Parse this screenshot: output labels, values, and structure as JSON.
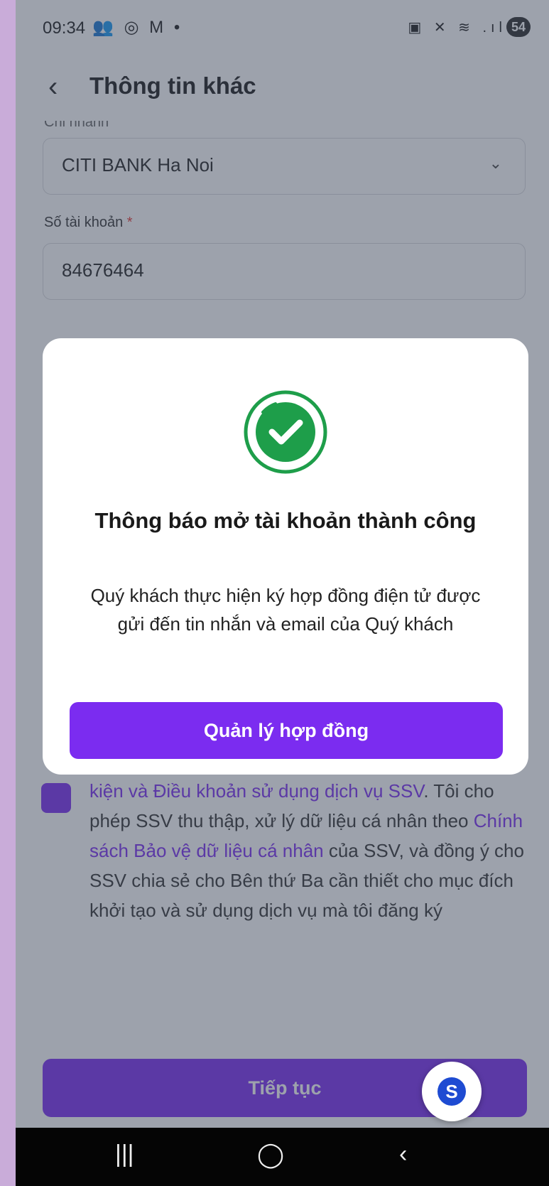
{
  "status_bar": {
    "time": "09:34",
    "left_icons": "👥 ◎ M •",
    "right_icons": "▣ ✕ ≋ .ıl",
    "battery": "54"
  },
  "header": {
    "title": "Thông tin khác",
    "back_icon": "chevron-left-icon"
  },
  "form": {
    "branch_label_partial": "Chi nhánh",
    "branch_value": "CITI BANK Ha Noi",
    "account_label": "Số tài khoản",
    "account_required": "*",
    "account_value": "84676464"
  },
  "consent": {
    "prefix": "kiện và Điều khoản sử dụng dịch vụ SSV",
    "text1": ". Tôi cho phép SSV thu thập, xử lý dữ liệu cá nhân theo ",
    "link2": "Chính sách Bảo vệ dữ liệu cá nhân",
    "text2": " của SSV, và đồng ý cho SSV chia sẻ cho Bên thứ Ba cần thiết cho mục đích khởi tạo và sử dụng dịch vụ mà tôi đăng ký"
  },
  "continue_label": "Tiếp tục",
  "fab_logo": "S",
  "modal": {
    "title": "Thông báo mở tài khoản thành công",
    "message": "Quý khách thực hiện ký hợp đồng điện tử được gửi đến tin nhắn và email của Quý khách",
    "button_label": "Quản lý hợp đồng"
  },
  "navbar": {
    "recents": "|||",
    "home": "◯",
    "back": "‹"
  },
  "colors": {
    "accent": "#7b2cf0",
    "success": "#1e9e4a",
    "overlay": "#3c465a"
  }
}
